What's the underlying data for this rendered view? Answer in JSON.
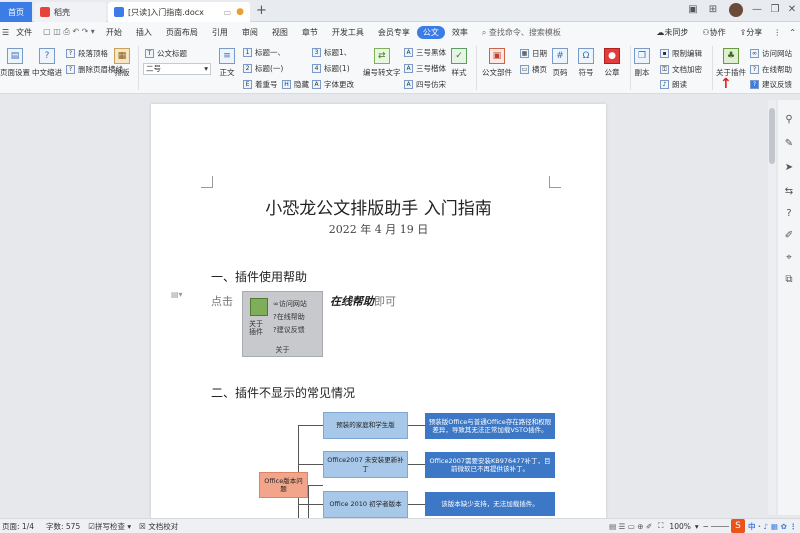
{
  "titlebar": {
    "home_tab": "首页",
    "app_tab": "稻壳",
    "doc_tab": "[只读]入门指南.docx",
    "add_tab": "+"
  },
  "menubar": {
    "file": "文件",
    "items": [
      "开始",
      "插入",
      "页面布局",
      "引用",
      "审阅",
      "视图",
      "章节",
      "开发工具",
      "会员专享",
      "公文",
      "效率"
    ],
    "active_item": "公文",
    "search_placeholder": "查找命令、搜索模板",
    "sync": "未同步",
    "collab": "协作",
    "share": "分享"
  },
  "ribbon": {
    "page_setup": "页面设置",
    "chinese_indent": "中文缩进",
    "paragraph_top": "段落顶格",
    "remove_header_line": "删除页眉横线",
    "layout": "排版",
    "doc_title": "公文标题",
    "font_size": "二号",
    "body_text": "正文",
    "heading1": "标题一、",
    "heading2": "标题(一)",
    "heading3": "标题1、",
    "heading4": "标题(1)",
    "signature": "着重号",
    "hide": "隐藏",
    "font_change": "字体更改",
    "num_to_text": "编号转文字",
    "font_hei": "三号黑体",
    "font_kai": "三号楷体",
    "font_fang": "四号仿宋",
    "style": "样式",
    "doc_parts": "公文部件",
    "date": "日期",
    "header_band": "横页",
    "page_num": "页码",
    "symbol": "符号",
    "seal": "公章",
    "copy": "副本",
    "restrict_edit": "限制编辑",
    "doc_encrypt": "文档加密",
    "read_aloud": "朗读",
    "about_plugin": "关于插件",
    "visit_site": "访问网站",
    "online_help": "在线帮助",
    "feedback": "建议反馈"
  },
  "document": {
    "title": "小恐龙公文排版助手 入门指南",
    "date": "2022 年 4 月 19 日",
    "section1": "一、插件使用帮助",
    "click_prefix": "点击",
    "click_suffix_bold": "在线帮助",
    "click_suffix": "即可",
    "plugin_box": {
      "about_line1": "关于",
      "about_line2": "插件",
      "visit_site": "访问网站",
      "online_help": "在线帮助",
      "feedback": "建议反馈",
      "footer": "关于"
    },
    "section2": "二、插件不显示的常见情况",
    "mindmap": {
      "root": "Office版本问题",
      "branches": [
        {
          "label": "预装的家庭和学生版",
          "note": "预装版Office与普通Office存在路径和权限差异，导致其无法正常加载VSTO插件。"
        },
        {
          "label": "Office2007 未安装更新补丁",
          "note": "Office2007需要安装KB976477补丁，目前微软已不再提供该补丁。"
        },
        {
          "label": "Office 2010 初学者版本",
          "note": "该版本缺少支持，无法加载插件。"
        }
      ]
    }
  },
  "statusbar": {
    "page": "页面: 1/4",
    "words": "字数: 575",
    "spell": "拼写检查",
    "proof": "文档校对",
    "zoom": "100%"
  },
  "colors": {
    "accent": "#3b7ce6",
    "mind_blue": "#a8c8ea",
    "mind_dark": "#3d78c6",
    "mind_orange": "#f2a58a",
    "annotation_red": "#e02020"
  }
}
